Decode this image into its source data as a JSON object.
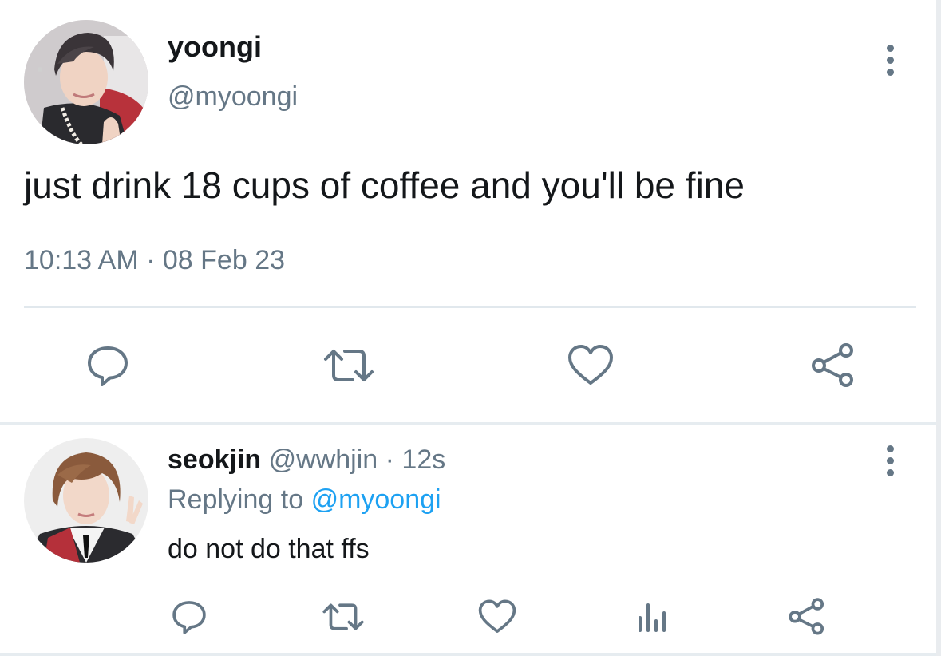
{
  "main_tweet": {
    "display_name": "yoongi",
    "handle": "@myoongi",
    "text": "just drink 18 cups of coffee and you'll be fine",
    "time": "10:13 AM",
    "separator": "·",
    "date": "08 Feb 23",
    "actions": [
      "reply-icon",
      "retweet-icon",
      "like-icon",
      "share-icon"
    ]
  },
  "reply": {
    "display_name": "seokjin",
    "handle": "@wwhjin",
    "separator": "·",
    "time": "12s",
    "replying_to_label": "Replying to",
    "replying_to_handle": "@myoongi",
    "text": "do not do that ffs",
    "actions": [
      "reply-icon",
      "retweet-icon",
      "like-icon",
      "analytics-icon",
      "share-icon"
    ]
  },
  "colors": {
    "text_primary": "#14171a",
    "text_secondary": "#657786",
    "link": "#1da1f2",
    "divider": "#e1e8ed"
  }
}
